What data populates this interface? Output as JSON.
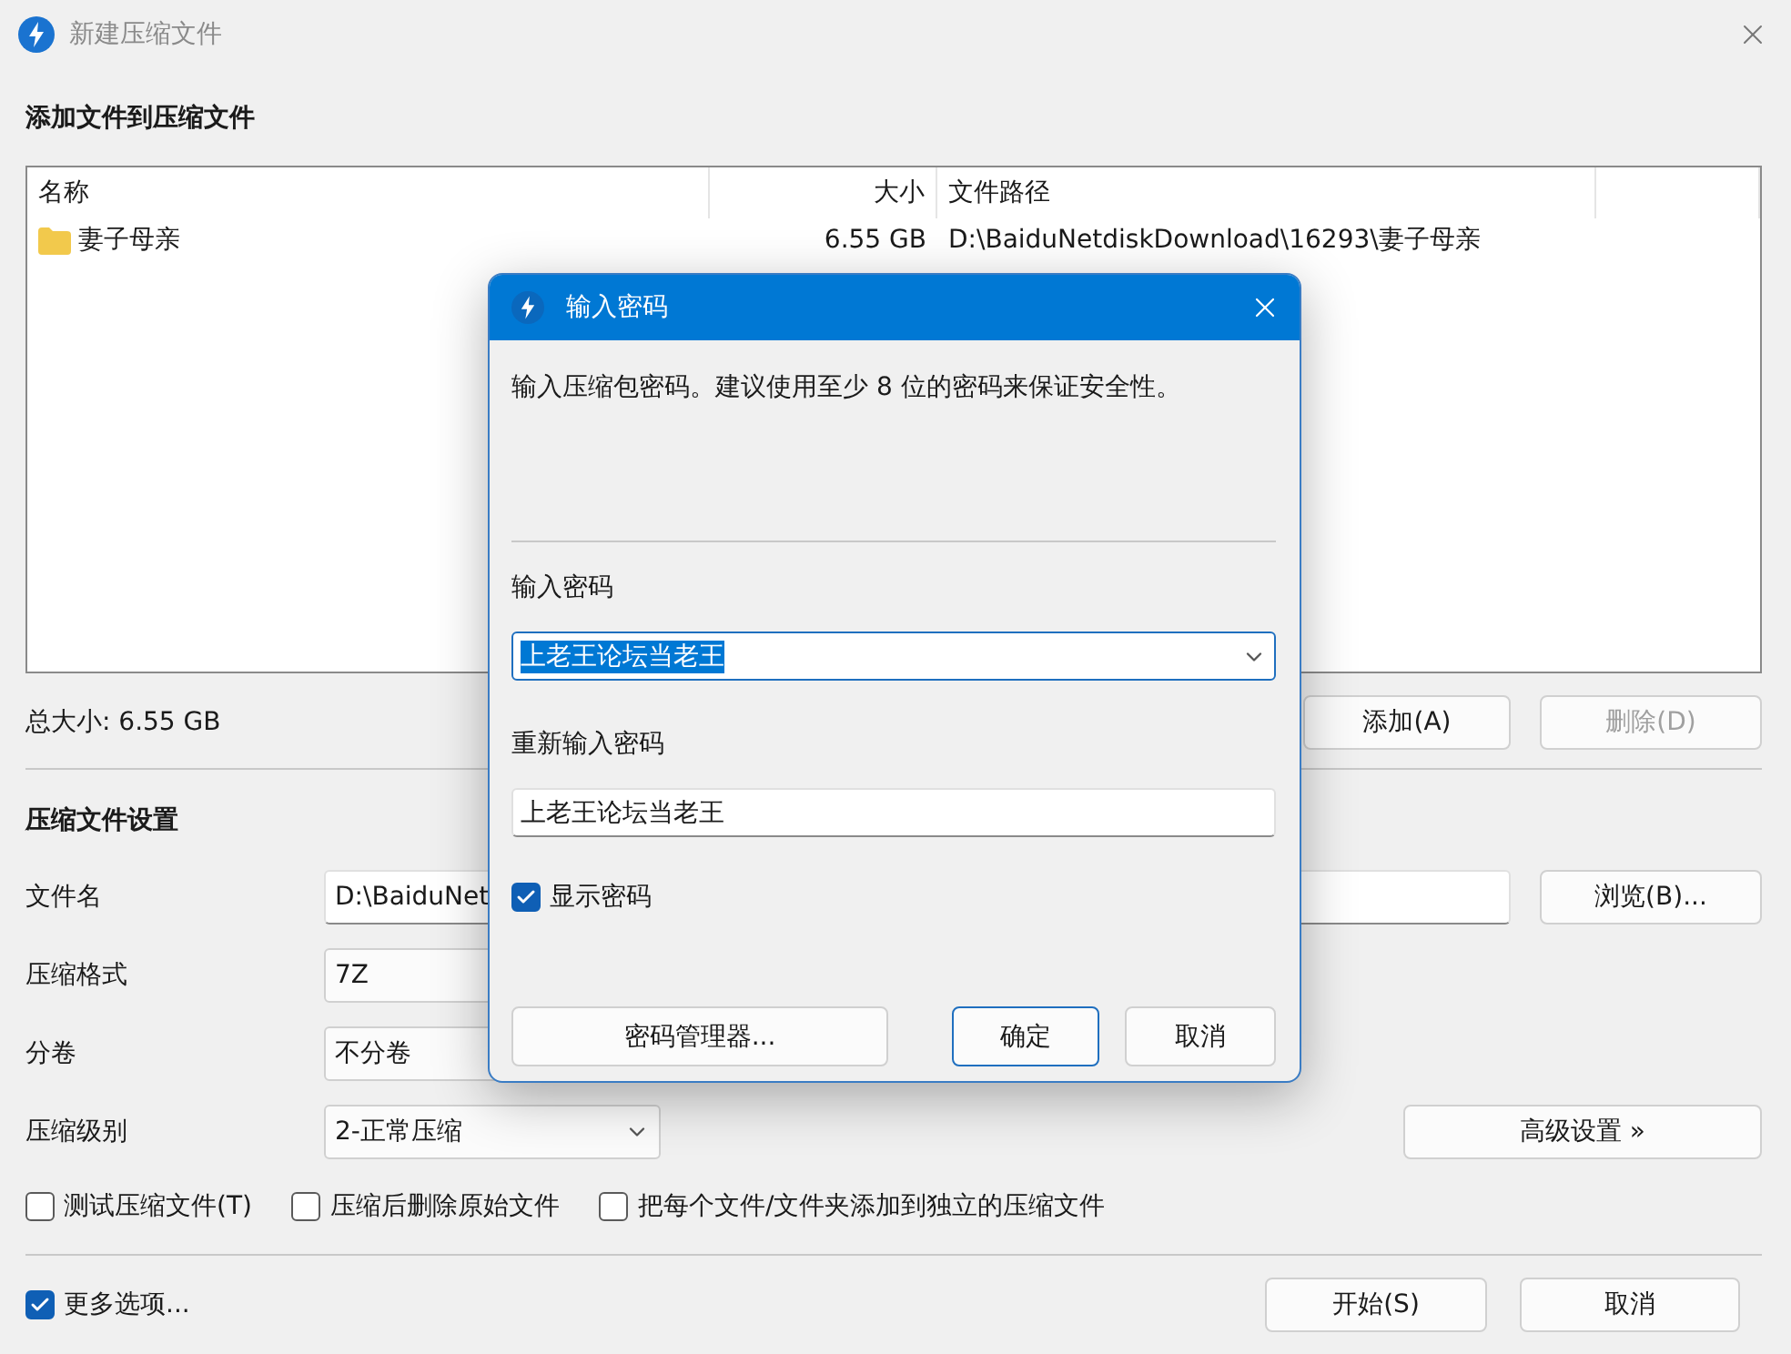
{
  "window": {
    "title": "新建压缩文件"
  },
  "main": {
    "section_title": "添加文件到压缩文件",
    "file_list": {
      "columns": [
        "名称",
        "大小",
        "文件路径"
      ],
      "rows": [
        {
          "kind": "folder",
          "name": "妻子母亲",
          "size": "6.55 GB",
          "path": "D:\\BaiduNetdiskDownload\\16293\\妻子母亲"
        }
      ]
    },
    "total_size": "总大小: 6.55 GB",
    "list_buttons": [
      {
        "label": "添加(A)",
        "disabled": false
      },
      {
        "label": "删除(D)",
        "disabled": true
      }
    ],
    "settings_title": "压缩文件设置",
    "settings": [
      {
        "label": "文件名",
        "kind": "text",
        "value": "D:\\BaiduNet"
      },
      {
        "label": "压缩格式",
        "kind": "combo",
        "value": "7Z"
      },
      {
        "label": "分卷",
        "kind": "combo",
        "value": "不分卷"
      },
      {
        "label": "压缩级别",
        "kind": "combo",
        "value": "2-正常压缩"
      }
    ],
    "browse_button": "浏览(B)...",
    "advanced_button": "高级设置 »",
    "options": [
      {
        "label": "测试压缩文件(T)",
        "checked": false
      },
      {
        "label": "压缩后删除原始文件",
        "checked": false
      },
      {
        "label": "把每个文件/文件夹添加到独立的压缩文件",
        "checked": false
      }
    ],
    "more_options": {
      "label": "更多选项...",
      "checked": true
    },
    "footer_buttons": [
      "开始(S)",
      "取消"
    ]
  },
  "dialog": {
    "title": "输入密码",
    "description": "输入压缩包密码。建议使用至少 8 位的密码来保证安全性。",
    "password_label": "输入密码",
    "password": {
      "value": "上老王论坛当老王",
      "selected": true
    },
    "confirm_label": "重新输入密码",
    "confirm": {
      "value": "上老王论坛当老王"
    },
    "show_password": {
      "label": "显示密码",
      "checked": true
    },
    "buttons": [
      {
        "label": "密码管理器...",
        "kind": "wide",
        "default": false
      },
      {
        "label": "确定",
        "kind": "normal",
        "default": true
      },
      {
        "label": "取消",
        "kind": "normal",
        "default": false
      }
    ]
  }
}
